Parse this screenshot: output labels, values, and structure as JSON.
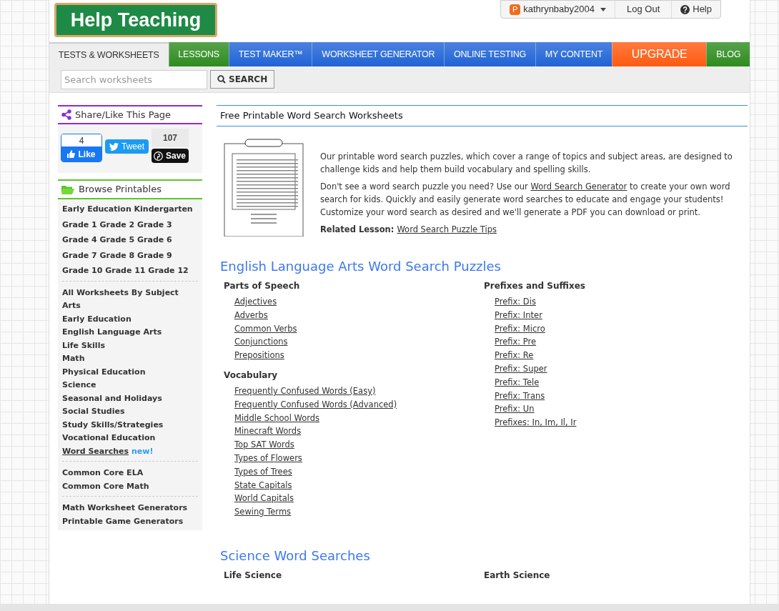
{
  "logo": {
    "text": "Help Teaching"
  },
  "user_bar": {
    "user_initial": "P",
    "username": "kathrynbaby2004",
    "logout": "Log Out",
    "help": "Help"
  },
  "nav_tabs": [
    {
      "label": "TESTS & WORKSHEETS",
      "selected": true,
      "color": "#eeeeee"
    },
    {
      "label": "LESSONS",
      "selected": false,
      "color": "#2e8b1e"
    },
    {
      "label": "TEST MAKER™",
      "selected": false,
      "color": "#1f63d6"
    },
    {
      "label": "WORKSHEET GENERATOR",
      "selected": false,
      "color": "#1f63d6"
    },
    {
      "label": "ONLINE TESTING",
      "selected": false,
      "color": "#1f63d6"
    },
    {
      "label": "MY CONTENT",
      "selected": false,
      "color": "#1f63d6"
    },
    {
      "label": "UPGRADE",
      "selected": false,
      "color": "#ff5a10"
    },
    {
      "label": "BLOG",
      "selected": false,
      "color": "#2e8b1e"
    }
  ],
  "search": {
    "placeholder": "Search worksheets",
    "button": "SEARCH"
  },
  "share": {
    "title": "Share/Like This Page",
    "like_count": "4",
    "like": "Like",
    "tweet": "Tweet",
    "save_count": "107",
    "save": "Save"
  },
  "browse": {
    "title": "Browse Printables",
    "groups": [
      [
        {
          "label": "Early Education Kindergarten"
        },
        {
          "label": "Grade 1 Grade 2 Grade 3"
        },
        {
          "label": "Grade 4 Grade 5 Grade 6"
        },
        {
          "label": "Grade 7 Grade 8 Grade 9"
        },
        {
          "label": "Grade 10 Grade 11 Grade 12"
        }
      ],
      [
        {
          "label": "All Worksheets By Subject"
        },
        {
          "label": "Arts"
        },
        {
          "label": "Early Education"
        },
        {
          "label": "English Language Arts"
        },
        {
          "label": "Life Skills"
        },
        {
          "label": "Math"
        },
        {
          "label": "Physical Education"
        },
        {
          "label": "Science"
        },
        {
          "label": "Seasonal and Holidays"
        },
        {
          "label": "Social Studies"
        },
        {
          "label": "Study Skills/Strategies"
        },
        {
          "label": "Vocational Education"
        },
        {
          "label": "Word Searches",
          "selected": true,
          "badge": "new!"
        }
      ],
      [
        {
          "label": "Common Core ELA"
        },
        {
          "label": "Common Core Math"
        }
      ],
      [
        {
          "label": "Math Worksheet Generators"
        },
        {
          "label": "Printable Game Generators"
        }
      ]
    ]
  },
  "main": {
    "title": "Free Printable Word Search Worksheets",
    "intro": "Our printable word search puzzles, which cover a range of topics and subject areas, are designed to challenge kids and help them build vocabulary and spelling skills.",
    "para_before_link": "Don't see a word search puzzle you need? Use our",
    "para_link": "Word Search Generator",
    "para_after_link": "to create your own word search for kids. Quickly and easily generate word searches to educate and engage your students! Customize your word search as desired and we'll generate a PDF you can download or print.",
    "related_label": "Related Lesson:",
    "related_link": "Word Search Puzzle Tips",
    "sections": [
      {
        "title": "English Language Arts Word Search Puzzles",
        "columns": [
          [
            {
              "heading": "Parts of Speech",
              "links": [
                "Adjectives",
                "Adverbs",
                "Common Verbs",
                "Conjunctions",
                "Prepositions"
              ]
            },
            {
              "heading": "Vocabulary",
              "links": [
                "Frequently Confused Words (Easy)",
                "Frequently Confused Words (Advanced)",
                "Middle School Words",
                "Minecraft Words",
                "Top SAT Words",
                "Types of Flowers",
                "Types of Trees",
                "State Capitals",
                "World Capitals",
                "Sewing Terms"
              ]
            }
          ],
          [
            {
              "heading": "Prefixes and Suffixes",
              "links": [
                "Prefix: Dis",
                "Prefix: Inter",
                "Prefix: Micro",
                "Prefix: Pre",
                "Prefix: Re",
                "Prefix: Super",
                "Prefix: Tele",
                "Prefix: Trans",
                "Prefix: Un",
                "Prefixes: In, Im, Il, Ir"
              ]
            }
          ]
        ]
      },
      {
        "title": "Science Word Searches",
        "columns": [
          [
            {
              "heading": "Life Science"
            }
          ],
          [
            {
              "heading": "Earth Science"
            }
          ]
        ]
      }
    ]
  }
}
